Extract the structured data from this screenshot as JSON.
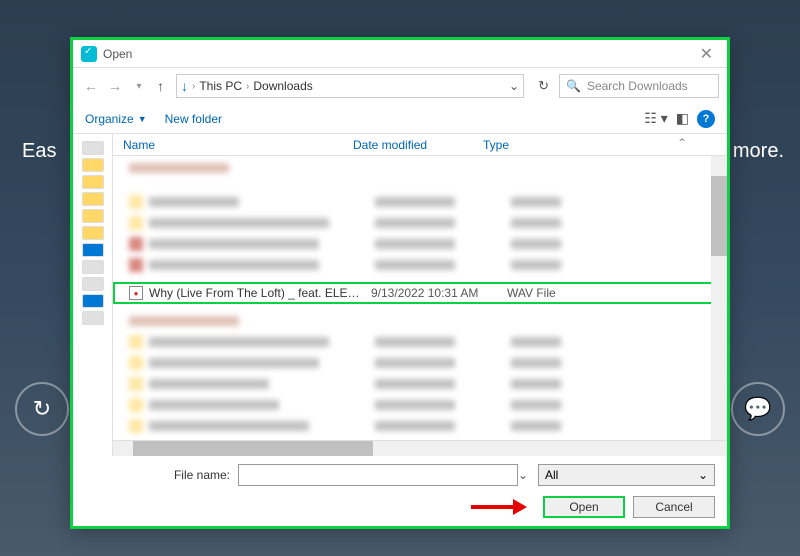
{
  "bg": {
    "left_text": "Eas",
    "right_text": "more."
  },
  "dialog": {
    "title": "Open"
  },
  "breadcrumb": {
    "root": "This PC",
    "folder": "Downloads"
  },
  "search": {
    "placeholder": "Search Downloads"
  },
  "toolbar": {
    "organize": "Organize",
    "newfolder": "New folder"
  },
  "columns": {
    "name": "Name",
    "date": "Date modified",
    "type": "Type"
  },
  "selected": {
    "name": "Why (Live From The Loft) _ feat. ELEVATI...",
    "date": "9/13/2022 10:31 AM",
    "type": "WAV File"
  },
  "bottom": {
    "filename_label": "File name:",
    "filter": "All",
    "open": "Open",
    "cancel": "Cancel"
  }
}
